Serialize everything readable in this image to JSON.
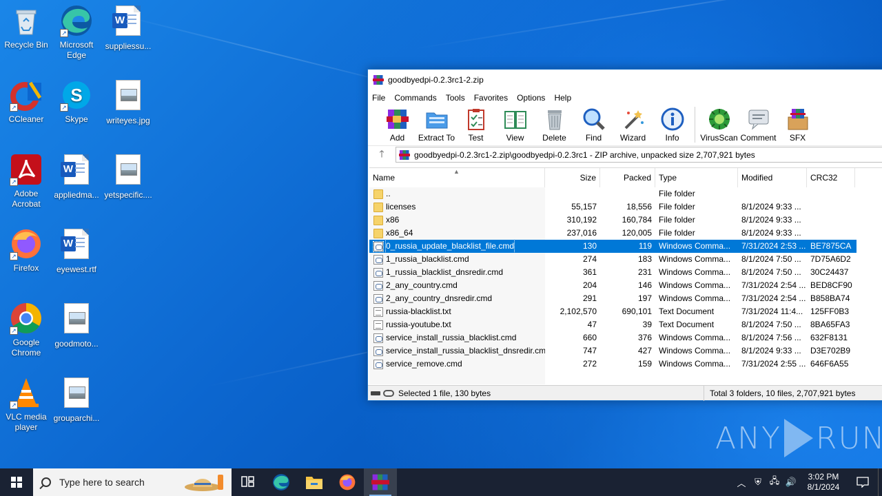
{
  "desktop": {
    "icons": [
      {
        "label": "Recycle Bin",
        "icon": "recycle-bin-icon"
      },
      {
        "label": "Microsoft Edge",
        "icon": "edge-icon"
      },
      {
        "label": "suppliessu...",
        "icon": "word-document-icon"
      },
      {
        "label": "CCleaner",
        "icon": "ccleaner-icon"
      },
      {
        "label": "Skype",
        "icon": "skype-icon"
      },
      {
        "label": "writeyes.jpg",
        "icon": "image-file-icon"
      },
      {
        "label": "Adobe Acrobat",
        "icon": "acrobat-icon"
      },
      {
        "label": "appliedma...",
        "icon": "word-document-icon"
      },
      {
        "label": "yetspecific....",
        "icon": "image-file-icon"
      },
      {
        "label": "Firefox",
        "icon": "firefox-icon"
      },
      {
        "label": "eyewest.rtf",
        "icon": "word-document-icon"
      },
      {
        "label": "Google Chrome",
        "icon": "chrome-icon"
      },
      {
        "label": "goodmoto...",
        "icon": "image-file-icon"
      },
      {
        "label": "VLC media player",
        "icon": "vlc-icon"
      },
      {
        "label": "grouparchi...",
        "icon": "image-file-icon"
      }
    ]
  },
  "window": {
    "title": "goodbyedpi-0.2.3rc1-2.zip",
    "menu": [
      "File",
      "Commands",
      "Tools",
      "Favorites",
      "Options",
      "Help"
    ],
    "toolbar": [
      "Add",
      "Extract To",
      "Test",
      "View",
      "Delete",
      "Find",
      "Wizard",
      "Info",
      "VirusScan",
      "Comment",
      "SFX"
    ],
    "address": "goodbyedpi-0.2.3rc1-2.zip\\goodbyedpi-0.2.3rc1 - ZIP archive, unpacked size 2,707,921 bytes",
    "columns": [
      "Name",
      "Size",
      "Packed",
      "Type",
      "Modified",
      "CRC32"
    ],
    "rows": [
      {
        "name": "..",
        "size": "",
        "packed": "",
        "type": "File folder",
        "modified": "",
        "crc": "",
        "kind": "folder"
      },
      {
        "name": "licenses",
        "size": "55,157",
        "packed": "18,556",
        "type": "File folder",
        "modified": "8/1/2024 9:33 ...",
        "crc": "",
        "kind": "folder"
      },
      {
        "name": "x86",
        "size": "310,192",
        "packed": "160,784",
        "type": "File folder",
        "modified": "8/1/2024 9:33 ...",
        "crc": "",
        "kind": "folder"
      },
      {
        "name": "x86_64",
        "size": "237,016",
        "packed": "120,005",
        "type": "File folder",
        "modified": "8/1/2024 9:33 ...",
        "crc": "",
        "kind": "folder"
      },
      {
        "name": "0_russia_update_blacklist_file.cmd",
        "size": "130",
        "packed": "119",
        "type": "Windows Comma...",
        "modified": "7/31/2024 2:53 ...",
        "crc": "BE7875CA",
        "kind": "cmd",
        "selected": true
      },
      {
        "name": "1_russia_blacklist.cmd",
        "size": "274",
        "packed": "183",
        "type": "Windows Comma...",
        "modified": "8/1/2024 7:50 ...",
        "crc": "7D75A6D2",
        "kind": "cmd"
      },
      {
        "name": "1_russia_blacklist_dnsredir.cmd",
        "size": "361",
        "packed": "231",
        "type": "Windows Comma...",
        "modified": "8/1/2024 7:50 ...",
        "crc": "30C24437",
        "kind": "cmd"
      },
      {
        "name": "2_any_country.cmd",
        "size": "204",
        "packed": "146",
        "type": "Windows Comma...",
        "modified": "7/31/2024 2:54 ...",
        "crc": "BED8CF90",
        "kind": "cmd"
      },
      {
        "name": "2_any_country_dnsredir.cmd",
        "size": "291",
        "packed": "197",
        "type": "Windows Comma...",
        "modified": "7/31/2024 2:54 ...",
        "crc": "B858BA74",
        "kind": "cmd"
      },
      {
        "name": "russia-blacklist.txt",
        "size": "2,102,570",
        "packed": "690,101",
        "type": "Text Document",
        "modified": "7/31/2024 11:4...",
        "crc": "125FF0B3",
        "kind": "txt"
      },
      {
        "name": "russia-youtube.txt",
        "size": "47",
        "packed": "39",
        "type": "Text Document",
        "modified": "8/1/2024 7:50 ...",
        "crc": "8BA65FA3",
        "kind": "txt"
      },
      {
        "name": "service_install_russia_blacklist.cmd",
        "size": "660",
        "packed": "376",
        "type": "Windows Comma...",
        "modified": "8/1/2024 7:56 ...",
        "crc": "632F8131",
        "kind": "cmd"
      },
      {
        "name": "service_install_russia_blacklist_dnsredir.cmd",
        "size": "747",
        "packed": "427",
        "type": "Windows Comma...",
        "modified": "8/1/2024 9:33 ...",
        "crc": "D3E702B9",
        "kind": "cmd"
      },
      {
        "name": "service_remove.cmd",
        "size": "272",
        "packed": "159",
        "type": "Windows Comma...",
        "modified": "7/31/2024 2:55 ...",
        "crc": "646F6A55",
        "kind": "cmd"
      }
    ],
    "status_left": "Selected 1 file, 130 bytes",
    "status_right": "Total 3 folders, 10 files, 2,707,921 bytes"
  },
  "watermark": {
    "left": "ANY",
    "right": "RUN"
  },
  "taskbar": {
    "search_placeholder": "Type here to search",
    "time": "3:02 PM",
    "date": "8/1/2024",
    "apps": [
      "task-view-icon",
      "edge-icon",
      "file-explorer-icon",
      "firefox-icon",
      "winrar-icon"
    ]
  },
  "colors": {
    "selection": "#0078d7",
    "taskbar": "#1a2233",
    "desktop": "#0c66cf"
  }
}
